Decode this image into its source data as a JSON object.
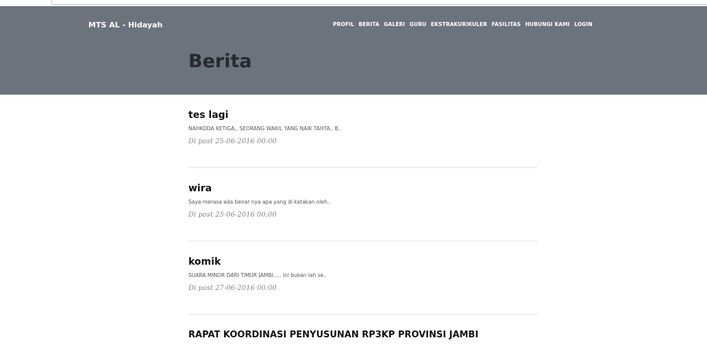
{
  "site": {
    "brand": "MTS AL - Hidayah"
  },
  "nav": {
    "items": [
      "PROFIL",
      "BERITA",
      "GALERI",
      "GURU",
      "EKSTRAKURIKULER",
      "FASILITAS",
      "HUBUNGI KAMI",
      "LOGIN"
    ]
  },
  "page": {
    "title": "Berita"
  },
  "posts": [
    {
      "title": "tes lagi",
      "excerpt": "NAHKODA KETIGA,. SEORANG WAKIL YANG NAIK TAHTA.. B..",
      "meta": "Di post 25-06-2016 00:00"
    },
    {
      "title": "wira",
      "excerpt": "Saya merasa ada benar nya apa yang di katakan oleh..",
      "meta": "Di post 25-06-2016 00:00"
    },
    {
      "title": "komik",
      "excerpt": "SUARA MINOR DARI TIMUR JAMBI..... Ini bukan lah se..",
      "meta": "Di post 27-06-2016 00:00"
    },
    {
      "title": "RAPAT KOORDINASI PENYUSUNAN RP3KP PROVINSI JAMBI"
    }
  ],
  "colors": {
    "header_bg": "#6c737c",
    "title_text": "#262a2e"
  }
}
